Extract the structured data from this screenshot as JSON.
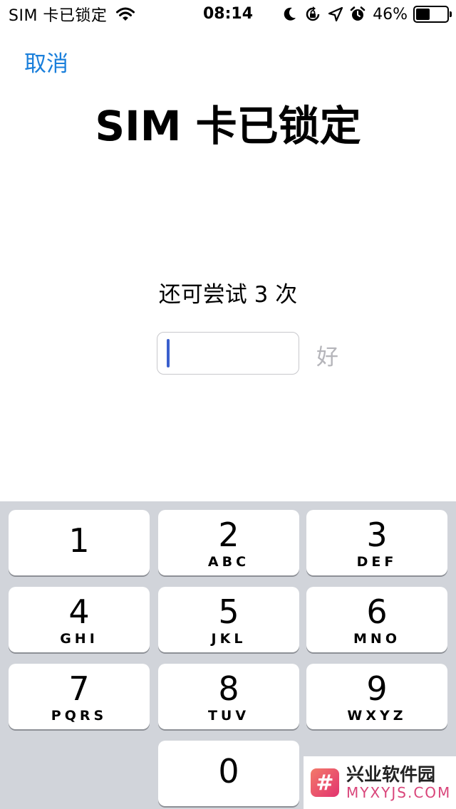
{
  "status_bar": {
    "carrier": "SIM 卡已锁定",
    "time": "08:14",
    "battery_text": "46%",
    "battery_level": 0.46,
    "icons": [
      "wifi-icon",
      "moon-icon",
      "rotation-lock-icon",
      "location-arrow-icon",
      "alarm-icon",
      "battery-icon"
    ]
  },
  "nav": {
    "cancel_label": "取消"
  },
  "page": {
    "title": "SIM 卡已锁定",
    "attempts_text": "还可尝试 3 次",
    "pin_value": "",
    "ok_label": "好"
  },
  "keypad": {
    "keys": [
      {
        "digit": "1",
        "letters": ""
      },
      {
        "digit": "2",
        "letters": "ABC"
      },
      {
        "digit": "3",
        "letters": "DEF"
      },
      {
        "digit": "4",
        "letters": "GHI"
      },
      {
        "digit": "5",
        "letters": "JKL"
      },
      {
        "digit": "6",
        "letters": "MNO"
      },
      {
        "digit": "7",
        "letters": "PQRS"
      },
      {
        "digit": "8",
        "letters": "TUV"
      },
      {
        "digit": "9",
        "letters": "WXYZ"
      },
      {
        "digit": "0",
        "letters": ""
      }
    ]
  },
  "watermark": {
    "logo_glyph": "#",
    "name": "兴业软件园",
    "domain": "MYXYJS.COM"
  },
  "colors": {
    "accent": "#1a7fdb",
    "keypad_bg": "#d1d4da",
    "caret": "#3a5fcd",
    "disabled": "#b5b5ba"
  }
}
